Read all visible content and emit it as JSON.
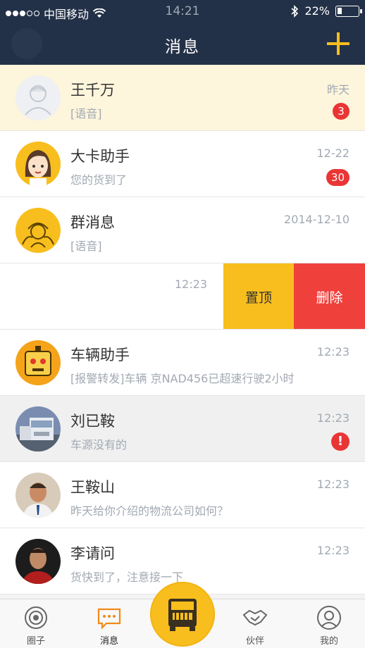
{
  "status": {
    "carrier": "中国移动",
    "time": "14:21",
    "battery": "22%",
    "battery_level": 0.22
  },
  "header": {
    "title": "消息"
  },
  "conversations": [
    {
      "name": "王千万",
      "preview": "[语音]",
      "time": "昨天",
      "badge": "3",
      "avatar": "default-user-icon"
    },
    {
      "name": "大卡助手",
      "preview": "您的货到了",
      "time": "12-22",
      "badge": "30",
      "avatar": "girl-avatar"
    },
    {
      "name": "群消息",
      "preview": "[语音]",
      "time": "2014-12-10",
      "avatar": "group-avatar"
    },
    {
      "name": "车辆助手",
      "preview": "[报警转发]车辆 京NAD456已超速行驶2小时",
      "time": "12:23",
      "avatar": "robot-avatar"
    },
    {
      "name": "刘已鞍",
      "preview": "车源没有的",
      "time": "12:23",
      "alert": "!",
      "avatar": "truck-photo"
    },
    {
      "name": "王鞍山",
      "preview": "昨天给你介绍的物流公司如何？",
      "time": "12:23",
      "avatar": "man-photo"
    },
    {
      "name": "李请问",
      "preview": "货快到了，注意接一下",
      "time": "12:23",
      "avatar": "man-photo-2"
    }
  ],
  "swiped_row": {
    "time": "12:23",
    "pin_label": "置顶",
    "delete_label": "删除"
  },
  "tabs": [
    {
      "label": "圈子",
      "icon": "circle-target-icon"
    },
    {
      "label": "消息",
      "icon": "chat-bubble-icon",
      "active": true
    },
    {
      "label": "伙伴",
      "icon": "handshake-icon"
    },
    {
      "label": "我的",
      "icon": "profile-icon"
    }
  ],
  "colors": {
    "nav": "#233148",
    "accent": "#f8be1d",
    "danger": "#f0403c",
    "badge": "#ea3535"
  }
}
